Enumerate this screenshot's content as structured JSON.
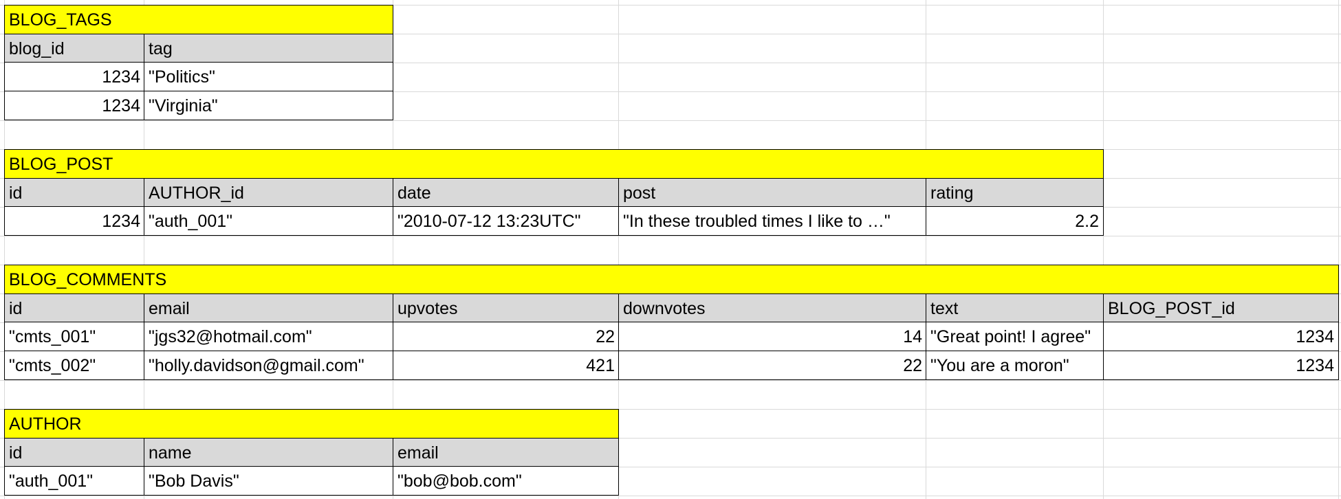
{
  "tables": {
    "blog_tags": {
      "title": "BLOG_TAGS",
      "columns": [
        "blog_id",
        "tag"
      ],
      "rows": [
        [
          "1234",
          "\"Politics\""
        ],
        [
          "1234",
          "\"Virginia\""
        ]
      ]
    },
    "blog_post": {
      "title": "BLOG_POST",
      "columns": [
        "id",
        "AUTHOR_id",
        "date",
        "post",
        "rating"
      ],
      "rows": [
        [
          "1234",
          "\"auth_001\"",
          "\"2010-07-12 13:23UTC\"",
          "\"In these troubled times I like to …\"",
          "2.2"
        ]
      ]
    },
    "blog_comments": {
      "title": "BLOG_COMMENTS",
      "columns": [
        "id",
        "email",
        "upvotes",
        "downvotes",
        "text",
        "BLOG_POST_id"
      ],
      "rows": [
        [
          "\"cmts_001\"",
          "\"jgs32@hotmail.com\"",
          "22",
          "14",
          "\"Great point! I agree\"",
          "1234"
        ],
        [
          "\"cmts_002\"",
          "\"holly.davidson@gmail.com\"",
          "421",
          "22",
          "\"You are a moron\"",
          "1234"
        ]
      ]
    },
    "author": {
      "title": "AUTHOR",
      "columns": [
        "id",
        "name",
        "email"
      ],
      "rows": [
        [
          "\"auth_001\"",
          "\"Bob Davis\"",
          "\"bob@bob.com\""
        ]
      ]
    }
  },
  "colors": {
    "title_fill": "#ffff00",
    "header_fill": "#d9d9d9",
    "gridline": "#d9d9d9",
    "border": "#000000"
  }
}
